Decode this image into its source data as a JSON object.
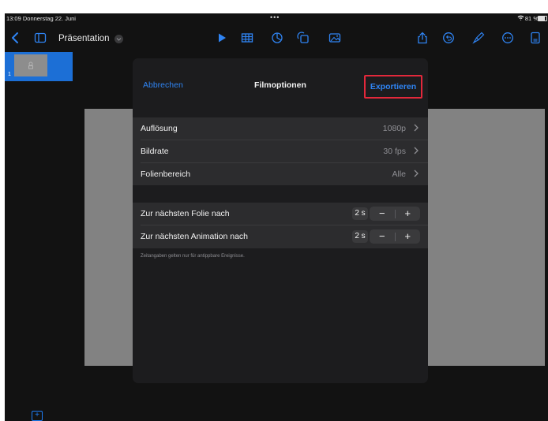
{
  "status_bar": {
    "time_date": "13:09  Donnerstag 22. Juni",
    "dots": "•••",
    "battery": "81 %"
  },
  "toolbar": {
    "document_title": "Präsentation"
  },
  "sidebar": {
    "slide_number": "1"
  },
  "sheet": {
    "cancel_label": "Abbrechen",
    "title": "Filmoptionen",
    "export_label": "Exportieren",
    "settings": [
      {
        "label": "Auflösung",
        "value": "1080p"
      },
      {
        "label": "Bildrate",
        "value": "30 fps"
      },
      {
        "label": "Folienbereich",
        "value": "Alle"
      }
    ],
    "timing": [
      {
        "label": "Zur nächsten Folie nach",
        "value": "2 s",
        "minus": "−",
        "plus": "+"
      },
      {
        "label": "Zur nächsten Animation nach",
        "value": "2 s",
        "minus": "−",
        "plus": "+"
      }
    ],
    "footnote": "Zeitangaben gelten nur für antippbare Ereignisse."
  },
  "colors": {
    "accent": "#2f84f3",
    "highlight_border": "#e3283b",
    "background": "#121212",
    "sheet": "#1c1c1e",
    "row": "#2c2c2e"
  },
  "icons": [
    "back-chevron-icon",
    "sidebar-toggle-icon",
    "play-icon",
    "table-icon",
    "chart-icon",
    "shapes-icon",
    "media-icon",
    "share-icon",
    "undo-icon",
    "format-brush-icon",
    "more-icon",
    "document-icon",
    "wifi-icon",
    "battery-icon"
  ]
}
